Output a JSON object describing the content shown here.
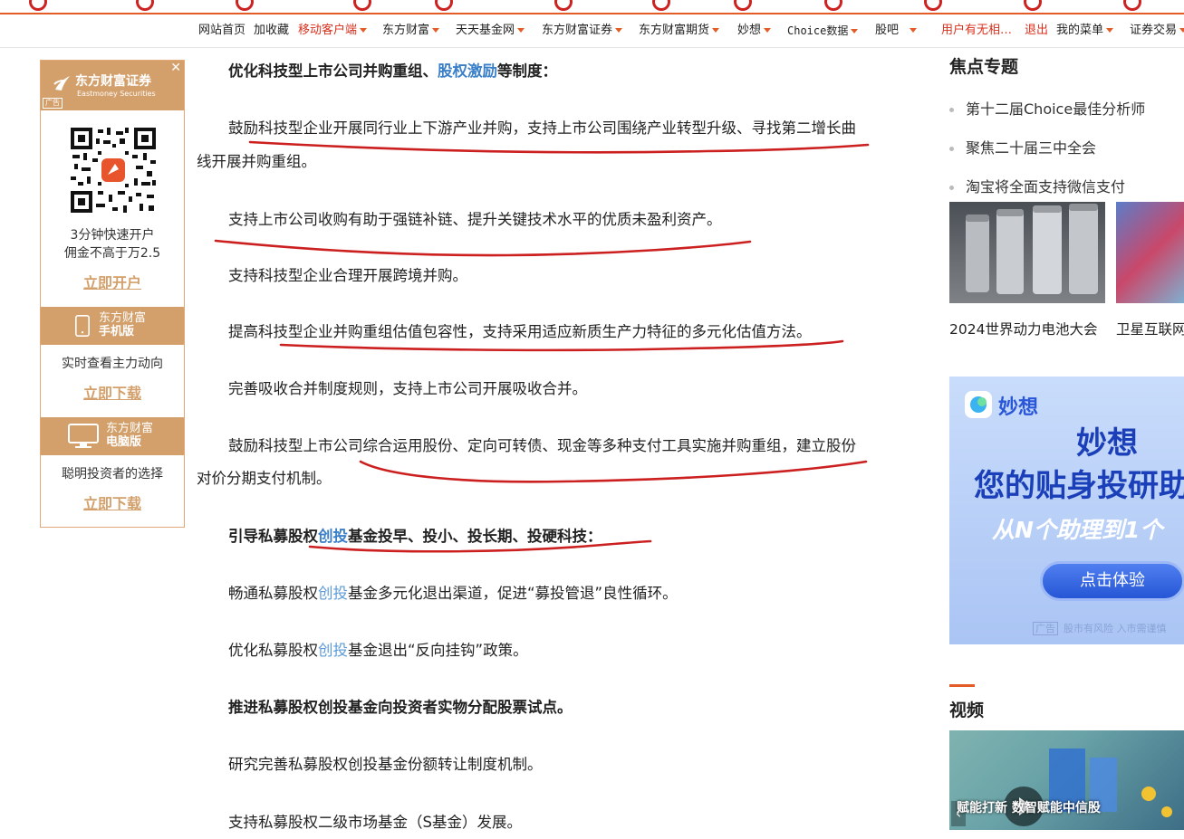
{
  "nav": {
    "items": [
      {
        "label": "网站首页",
        "red": false,
        "caret": false
      },
      {
        "label": "加收藏",
        "red": false,
        "caret": false
      },
      {
        "label": "移动客户端",
        "red": true,
        "caret": true
      },
      {
        "label": "东方财富",
        "red": false,
        "caret": true
      },
      {
        "label": "天天基金网",
        "red": false,
        "caret": true
      },
      {
        "label": "东方财富证券",
        "red": false,
        "caret": true
      },
      {
        "label": "东方财富期货",
        "red": false,
        "caret": true
      },
      {
        "label": "妙想",
        "red": false,
        "caret": true
      },
      {
        "label": "Choice数据",
        "red": false,
        "caret": true
      },
      {
        "label": "股吧",
        "red": false,
        "caret": true
      },
      {
        "label": "用户有无相…",
        "red": true,
        "caret": false
      },
      {
        "label": "退出",
        "red": true,
        "caret": false
      },
      {
        "label": "我的菜单",
        "red": false,
        "caret": true
      },
      {
        "label": "证券交易",
        "red": false,
        "caret": true
      }
    ]
  },
  "left_ad": {
    "brand": "东方财富证券",
    "brand_en": "Eastmoney Securities",
    "ad_tag": "广告",
    "close": "✕",
    "qr_text_1": "3分钟快速开户",
    "qr_text_2": "佣金不高于万2.5",
    "open_link": "立即开户",
    "mobile_band_1": "东方财富",
    "mobile_band_2": "手机版",
    "mobile_text": "实时查看主力动向",
    "mobile_link": "立即下载",
    "pc_band_1": "东方财富",
    "pc_band_2": "电脑版",
    "pc_text": "聪明投资者的选择",
    "pc_link": "立即下载"
  },
  "article": {
    "p1_a": "优化科技型上市公司并购重组、",
    "p1_link": "股权激励",
    "p1_b": "等制度：",
    "p2": "鼓励科技型企业开展同行业上下游产业并购，支持上市公司围绕产业转型升级、寻找第二增长曲",
    "p2_cont": "线开展并购重组。",
    "p3": "支持上市公司收购有助于强链补链、提升关键技术水平的优质未盈利资产。",
    "p4": "支持科技型企业合理开展跨境并购。",
    "p5": "提高科技型企业并购重组估值包容性，支持采用适应新质生产力特征的多元化估值方法。",
    "p6": "完善吸收合并制度规则，支持上市公司开展吸收合并。",
    "p7": "鼓励科技型上市公司综合运用股份、定向可转债、现金等多种支付工具实施并购重组，建立股份",
    "p7_cont": "对价分期支付机制。",
    "p8_a": "引导私募股权",
    "p8_link": "创投",
    "p8_b": "基金投早、投小、投长期、投硬科技：",
    "p9_a": "畅通私募股权",
    "p9_link": "创投",
    "p9_b": "基金多元化退出渠道，促进“募投管退”良性循环。",
    "p10_a": "优化私募股权",
    "p10_link": "创投",
    "p10_b": "基金退出“反向挂钩”政策。",
    "p11": "推进私募股权创投基金向投资者实物分配股票试点。",
    "p12": "研究完善私募股权创投基金份额转让制度机制。",
    "p13": "支持私募股权二级市场基金（S基金）发展。"
  },
  "sidebar": {
    "focus_title": "焦点专题",
    "focus_items": [
      "第十二届Choice最佳分析师",
      "聚焦二十届三中全会",
      "淘宝将全面支持微信支付"
    ],
    "thumb1_caption": "2024世界动力电池大会",
    "thumb2_caption": "卫星互联网",
    "miao_logo": "妙想",
    "miao_big1": "妙想",
    "miao_big2": "您的贴身投研助",
    "miao_sub": "从N个助理到1个",
    "miao_btn": "点击体验",
    "miao_ad_tag": "广告",
    "miao_foot": "股市有风险 入市需谨慎",
    "video_title": "视频",
    "video_caption": "赋能打新 数智赋能中信股"
  },
  "colors": {
    "accent": "#e35b26",
    "ink_red": "#cc1f1f",
    "link_blue": "#3a7fc8",
    "ad_gold": "#d39f6a"
  }
}
